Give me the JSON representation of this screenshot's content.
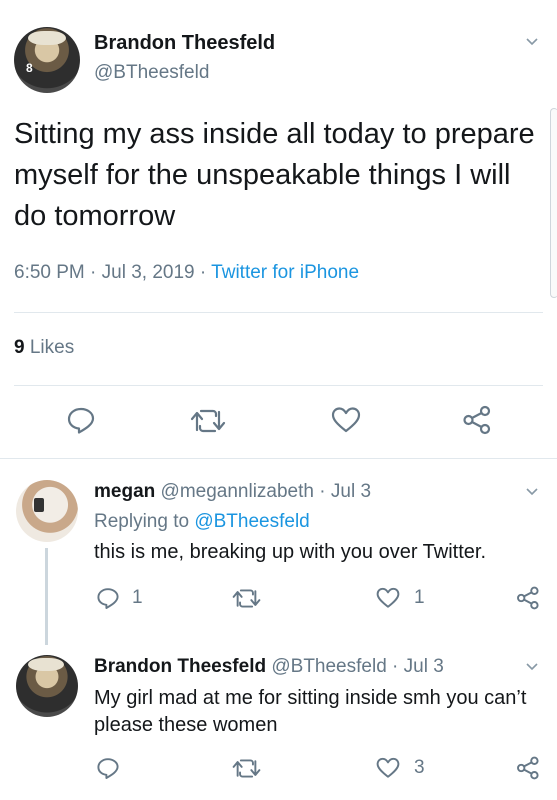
{
  "main_tweet": {
    "author_name": "Brandon Theesfeld",
    "handle": "@BTheesfeld",
    "text": "Sitting my ass inside all today to prepare myself for the unspeakable things I will do tomorrow",
    "time": "6:50 PM",
    "date": "Jul 3, 2019",
    "source": "Twitter for iPhone",
    "likes_count": "9",
    "likes_label": "Likes",
    "avatar_number": "8"
  },
  "replies": [
    {
      "author_name": "megan",
      "handle": "@megannlizabeth",
      "date": "Jul 3",
      "replying_prefix": "Replying to",
      "replying_to": "@BTheesfeld",
      "text": "this is me, breaking up with you over Twitter.",
      "reply_count": "1",
      "like_count": "1"
    },
    {
      "author_name": "Brandon Theesfeld",
      "handle": "@BTheesfeld",
      "date": "Jul 3",
      "text": "My girl mad at me for sitting inside smh you can’t please these women",
      "like_count": "3"
    }
  ],
  "separator": "·",
  "colors": {
    "link": "#1b95e0",
    "muted": "#657786",
    "divider": "#e1e8ed"
  },
  "icons": [
    "chevron-down-icon",
    "reply-icon",
    "retweet-icon",
    "like-icon",
    "share-icon"
  ]
}
